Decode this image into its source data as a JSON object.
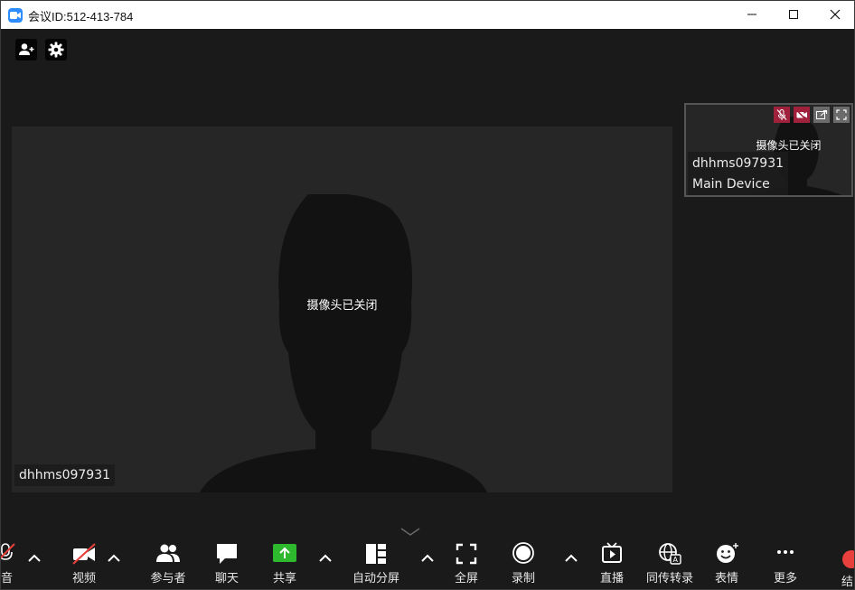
{
  "window": {
    "title": "会议ID:512-413-784",
    "min_label": "minimize",
    "max_label": "maximize",
    "close_label": "close"
  },
  "main_video": {
    "camera_status": "摄像头已关闭",
    "participant_name": "dhhms097931"
  },
  "thumbnail": {
    "camera_status": "摄像头已关闭",
    "participant_name": "dhhms097931",
    "device_name": "Main Device"
  },
  "toolbar": {
    "audio_label": "音",
    "video_label": "视频",
    "participants_label": "参与者",
    "chat_label": "聊天",
    "share_label": "共享",
    "layout_label": "自动分屏",
    "fullscreen_label": "全屏",
    "record_label": "录制",
    "live_label": "直播",
    "translate_label": "同传转录",
    "reactions_label": "表情",
    "more_label": "更多",
    "end_label": "结"
  },
  "colors": {
    "background": "#1a1a1a",
    "video_tile": "#262626",
    "silhouette": "#121212",
    "share_green": "#2eb82e",
    "muted_red": "#a0213c",
    "end_red": "#e8403c",
    "app_blue": "#2d8cff"
  }
}
